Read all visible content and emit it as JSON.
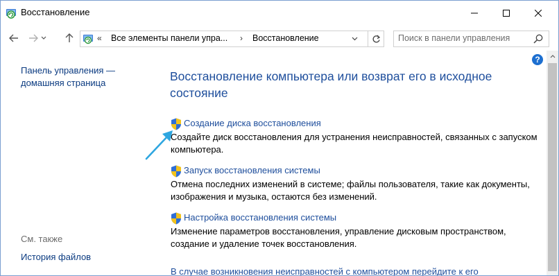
{
  "window": {
    "title": "Восстановление",
    "accent_color": "#1e4e9c"
  },
  "address": {
    "chevrons": "«",
    "crumbs": [
      "Все элементы панели упра...",
      "Восстановление"
    ],
    "separator": "›"
  },
  "search": {
    "placeholder": "Поиск в панели управления"
  },
  "sidebar": {
    "home_link": "Панель управления — домашняя страница",
    "see_also_label": "См. также",
    "history_link": "История файлов"
  },
  "main": {
    "heading": "Восстановление компьютера или возврат его в исходное состояние",
    "tasks": [
      {
        "label": "Создание диска восстановления",
        "description": "Создайте диск восстановления для устранения неисправностей, связанных с запуском компьютера."
      },
      {
        "label": "Запуск восстановления системы",
        "description": "Отмена последних изменений в системе; файлы пользователя, такие как документы, изображения и музыка, остаются без изменений."
      },
      {
        "label": "Настройка восстановления системы",
        "description": "Изменение параметров восстановления, управление дисковым пространством, создание и удаление точек восстановления."
      }
    ],
    "bottom_link": "В случае возникновения неисправностей с компьютером перейдите к его"
  },
  "help": {
    "label": "?"
  },
  "icons": [
    "recovery-icon",
    "back-arrow-icon",
    "forward-arrow-icon",
    "up-arrow-icon",
    "control-panel-icon",
    "refresh-icon",
    "search-icon",
    "help-icon",
    "uac-shield-icon",
    "annotation-arrow-icon"
  ]
}
